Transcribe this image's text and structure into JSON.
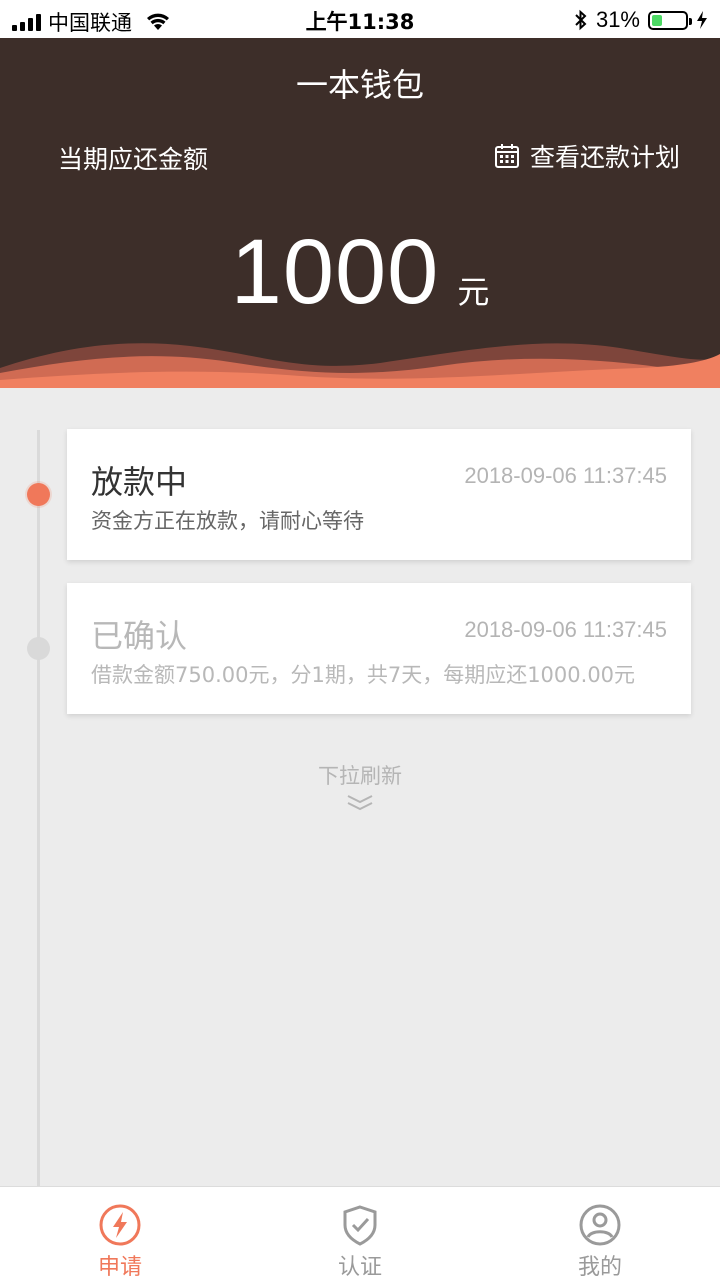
{
  "status_bar": {
    "carrier": "中国联通",
    "time": "上午11:38",
    "battery": "31%",
    "battery_level": 0.31
  },
  "header": {
    "title": "一本钱包",
    "due_label": "当期应还金额",
    "plan_link": "查看还款计划",
    "amount": "1000",
    "amount_unit": "元"
  },
  "timeline": [
    {
      "title": "放款中",
      "time": "2018-09-06 11:37:45",
      "desc": "资金方正在放款，请耐心等待",
      "active": true
    },
    {
      "title": "已确认",
      "time": "2018-09-06 11:37:45",
      "desc": "借款金额750.00元，分1期，共7天，每期应还1000.00元",
      "active": false
    }
  ],
  "pull_hint": "下拉刷新",
  "tabbar": {
    "tabs": [
      {
        "label": "申请",
        "icon": "lightning-icon",
        "active": true
      },
      {
        "label": "认证",
        "icon": "shield-check-icon",
        "active": false
      },
      {
        "label": "我的",
        "icon": "user-icon",
        "active": false
      }
    ]
  },
  "colors": {
    "header_bg": "#3d2e29",
    "accent": "#f0785a",
    "page_bg": "#ececec"
  }
}
